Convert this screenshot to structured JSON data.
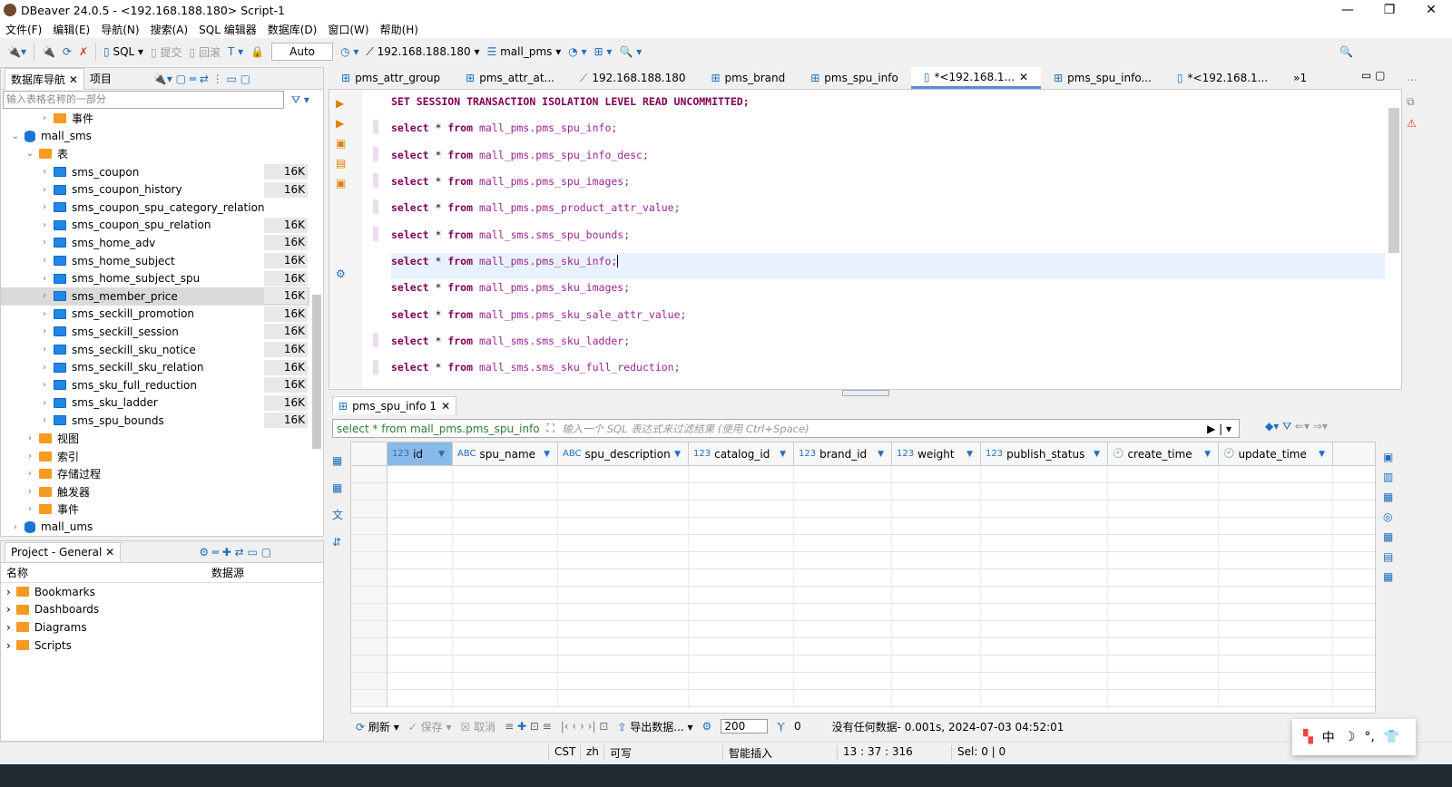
{
  "window": {
    "title": "DBeaver 24.0.5 - <192.168.188.180> Script-1",
    "controls": [
      "—",
      "❐",
      "✕"
    ]
  },
  "menu": [
    "文件(F)",
    "编辑(E)",
    "导航(N)",
    "搜索(A)",
    "SQL 编辑器",
    "数据库(D)",
    "窗口(W)",
    "帮助(H)"
  ],
  "toolbar": {
    "sql": "SQL",
    "commit": "提交",
    "rollback": "回滚",
    "mode": "Auto",
    "connection": "192.168.188.180",
    "database": "mall_pms"
  },
  "navigator": {
    "tab": "数据库导航",
    "project_tab": "项目",
    "filter_placeholder": "输入表格名称的一部分",
    "tree": [
      {
        "label": "事件",
        "indent": 4,
        "type": "folder",
        "tw": "›"
      },
      {
        "label": "mall_sms",
        "indent": 2,
        "type": "db",
        "tw": "⌄"
      },
      {
        "label": "表",
        "indent": 3,
        "type": "folder",
        "tw": "⌄"
      },
      {
        "label": "sms_coupon",
        "indent": 4,
        "type": "table",
        "size": "16K",
        "tw": "›"
      },
      {
        "label": "sms_coupon_history",
        "indent": 4,
        "type": "table",
        "size": "16K",
        "tw": "›"
      },
      {
        "label": "sms_coupon_spu_category_relation",
        "indent": 4,
        "type": "table",
        "size": "",
        "tw": "›"
      },
      {
        "label": "sms_coupon_spu_relation",
        "indent": 4,
        "type": "table",
        "size": "16K",
        "tw": "›"
      },
      {
        "label": "sms_home_adv",
        "indent": 4,
        "type": "table",
        "size": "16K",
        "tw": "›"
      },
      {
        "label": "sms_home_subject",
        "indent": 4,
        "type": "table",
        "size": "16K",
        "tw": "›"
      },
      {
        "label": "sms_home_subject_spu",
        "indent": 4,
        "type": "table",
        "size": "16K",
        "tw": "›"
      },
      {
        "label": "sms_member_price",
        "indent": 4,
        "type": "table",
        "size": "16K",
        "tw": "›",
        "selected": true
      },
      {
        "label": "sms_seckill_promotion",
        "indent": 4,
        "type": "table",
        "size": "16K",
        "tw": "›"
      },
      {
        "label": "sms_seckill_session",
        "indent": 4,
        "type": "table",
        "size": "16K",
        "tw": "›"
      },
      {
        "label": "sms_seckill_sku_notice",
        "indent": 4,
        "type": "table",
        "size": "16K",
        "tw": "›"
      },
      {
        "label": "sms_seckill_sku_relation",
        "indent": 4,
        "type": "table",
        "size": "16K",
        "tw": "›"
      },
      {
        "label": "sms_sku_full_reduction",
        "indent": 4,
        "type": "table",
        "size": "16K",
        "tw": "›"
      },
      {
        "label": "sms_sku_ladder",
        "indent": 4,
        "type": "table",
        "size": "16K",
        "tw": "›"
      },
      {
        "label": "sms_spu_bounds",
        "indent": 4,
        "type": "table",
        "size": "16K",
        "tw": "›"
      },
      {
        "label": "视图",
        "indent": 3,
        "type": "folder",
        "tw": "›"
      },
      {
        "label": "索引",
        "indent": 3,
        "type": "folder",
        "tw": "›"
      },
      {
        "label": "存储过程",
        "indent": 3,
        "type": "folder",
        "tw": "›"
      },
      {
        "label": "触发器",
        "indent": 3,
        "type": "folder",
        "tw": "›"
      },
      {
        "label": "事件",
        "indent": 3,
        "type": "folder",
        "tw": "›"
      },
      {
        "label": "mall_ums",
        "indent": 2,
        "type": "db",
        "tw": "›"
      }
    ]
  },
  "project": {
    "tab": "Project - General",
    "col_name": "名称",
    "col_source": "数据源",
    "items": [
      "Bookmarks",
      "Dashboards",
      "Diagrams",
      "Scripts"
    ]
  },
  "editor_tabs": [
    {
      "label": "pms_attr_group",
      "icon": "table"
    },
    {
      "label": "pms_attr_at...",
      "icon": "table"
    },
    {
      "label": "192.168.188.180",
      "icon": "connection"
    },
    {
      "label": "pms_brand",
      "icon": "table"
    },
    {
      "label": "pms_spu_info",
      "icon": "table"
    },
    {
      "label": "*<192.168.1...",
      "icon": "script",
      "active": true
    },
    {
      "label": "pms_spu_info...",
      "icon": "table"
    },
    {
      "label": "*<192.168.1...",
      "icon": "script"
    },
    {
      "label": "»1",
      "icon": "more"
    }
  ],
  "editor": {
    "first_line": "SET SESSION TRANSACTION ISOLATION LEVEL READ UNCOMMITTED;",
    "kw_select": "select",
    "kw_from": "from",
    "tables": [
      "mall_pms.pms_spu_info;",
      "mall_pms.pms_spu_info_desc;",
      "mall_pms.pms_spu_images;",
      "mall_pms.pms_product_attr_value;",
      "mall_sms.sms_spu_bounds;",
      "mall_pms.pms_sku_info;",
      "mall_pms.pms_sku_images;",
      "mall_pms.pms_sku_sale_attr_value;",
      "mall_sms.sms_sku_ladder;",
      "mall_sms.sms_sku_full_reduction;"
    ],
    "current_line": 6
  },
  "results": {
    "tab": "pms_spu_info 1",
    "query": "select * from mall_pms.pms_spu_info",
    "filter_placeholder": "输入一个 SQL 表达式来过滤结果 (使用 Ctrl+Space)",
    "columns": [
      {
        "name": "id",
        "type": "123"
      },
      {
        "name": "spu_name",
        "type": "ABC"
      },
      {
        "name": "spu_description",
        "type": "ABC"
      },
      {
        "name": "catalog_id",
        "type": "123"
      },
      {
        "name": "brand_id",
        "type": "123"
      },
      {
        "name": "weight",
        "type": "123"
      },
      {
        "name": "publish_status",
        "type": "123"
      },
      {
        "name": "create_time",
        "type": "🕘"
      },
      {
        "name": "update_time",
        "type": "🕘"
      }
    ],
    "refresh": "刷新",
    "save": "保存",
    "cancel": "取消",
    "export": "导出数据...",
    "fetch_size": "200",
    "count": "0",
    "message": "没有任何数据- 0.001s, 2024-07-03 04:52:01"
  },
  "statusbar": {
    "tz": "CST",
    "locale": "zh",
    "mode": "可写",
    "insert": "智能插入",
    "pos": "13 : 37 : 316",
    "sel": "Sel: 0 | 0"
  },
  "ime": {
    "lang": "中"
  }
}
